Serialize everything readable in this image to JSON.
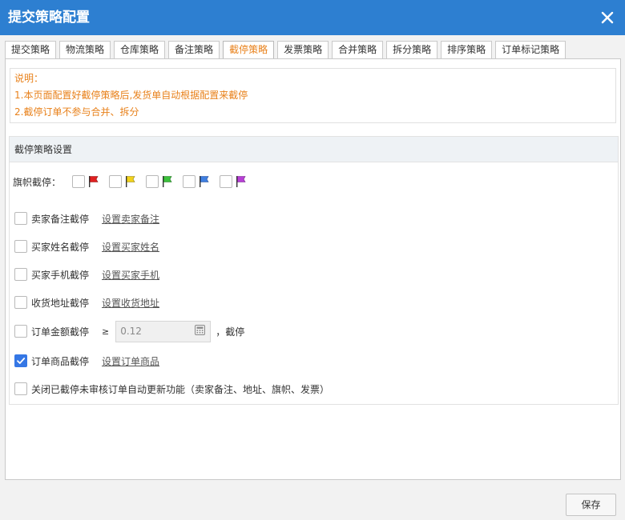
{
  "dialog": {
    "title": "提交策略配置"
  },
  "tabs": [
    {
      "label": "提交策略"
    },
    {
      "label": "物流策略"
    },
    {
      "label": "仓库策略"
    },
    {
      "label": "备注策略"
    },
    {
      "label": "截停策略"
    },
    {
      "label": "发票策略"
    },
    {
      "label": "合并策略"
    },
    {
      "label": "拆分策略"
    },
    {
      "label": "排序策略"
    },
    {
      "label": "订单标记策略"
    }
  ],
  "active_tab": "截停策略",
  "notice": {
    "title": "说明：",
    "lines": [
      "1.本页面配置好截停策略后,发货单自动根据配置来截停",
      "2.截停订单不参与合并、拆分"
    ],
    "color": "#e8811b"
  },
  "section": {
    "title": "截停策略设置",
    "flag_label": "旗帜截停：",
    "flags": [
      {
        "icon": "red-flag-icon",
        "color": "#e02020",
        "checked": false
      },
      {
        "icon": "yellow-flag-icon",
        "color": "#f2d21b",
        "checked": false
      },
      {
        "icon": "green-flag-icon",
        "color": "#3cc13c",
        "checked": false
      },
      {
        "icon": "blue-flag-icon",
        "color": "#3f7fe0",
        "checked": false
      },
      {
        "icon": "purple-flag-icon",
        "color": "#b83fd6",
        "checked": false
      }
    ],
    "options": [
      {
        "label": "卖家备注截停",
        "link": "设置卖家备注",
        "checked": false
      },
      {
        "label": "买家姓名截停",
        "link": "设置买家姓名",
        "checked": false
      },
      {
        "label": "买家手机截停",
        "link": "设置买家手机",
        "checked": false
      },
      {
        "label": "收货地址截停",
        "link": "设置收货地址",
        "checked": false
      },
      {
        "label": "订单金额截停",
        "operator": "≥",
        "value": "0.12",
        "suffix": "，截停",
        "checked": false
      },
      {
        "label": "订单商品截停",
        "link": "设置订单商品",
        "checked": true
      },
      {
        "label": "关闭已截停未审核订单自动更新功能（卖家备注、地址、旗帜、发票）",
        "checked": false
      }
    ]
  },
  "footer": {
    "save_label": "保存"
  },
  "colors": {
    "titlebar": "#2d7fd1",
    "accent": "#e8811b",
    "checkbox_checked": "#3577e5"
  }
}
